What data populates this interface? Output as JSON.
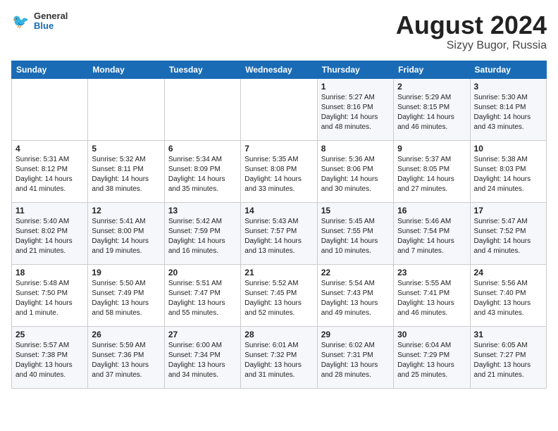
{
  "header": {
    "logo_line1": "General",
    "logo_line2": "Blue",
    "month_year": "August 2024",
    "location": "Sizyy Bugor, Russia"
  },
  "days_of_week": [
    "Sunday",
    "Monday",
    "Tuesday",
    "Wednesday",
    "Thursday",
    "Friday",
    "Saturday"
  ],
  "weeks": [
    [
      {
        "day": "",
        "info": ""
      },
      {
        "day": "",
        "info": ""
      },
      {
        "day": "",
        "info": ""
      },
      {
        "day": "",
        "info": ""
      },
      {
        "day": "1",
        "info": "Sunrise: 5:27 AM\nSunset: 8:16 PM\nDaylight: 14 hours\nand 48 minutes."
      },
      {
        "day": "2",
        "info": "Sunrise: 5:29 AM\nSunset: 8:15 PM\nDaylight: 14 hours\nand 46 minutes."
      },
      {
        "day": "3",
        "info": "Sunrise: 5:30 AM\nSunset: 8:14 PM\nDaylight: 14 hours\nand 43 minutes."
      }
    ],
    [
      {
        "day": "4",
        "info": "Sunrise: 5:31 AM\nSunset: 8:12 PM\nDaylight: 14 hours\nand 41 minutes."
      },
      {
        "day": "5",
        "info": "Sunrise: 5:32 AM\nSunset: 8:11 PM\nDaylight: 14 hours\nand 38 minutes."
      },
      {
        "day": "6",
        "info": "Sunrise: 5:34 AM\nSunset: 8:09 PM\nDaylight: 14 hours\nand 35 minutes."
      },
      {
        "day": "7",
        "info": "Sunrise: 5:35 AM\nSunset: 8:08 PM\nDaylight: 14 hours\nand 33 minutes."
      },
      {
        "day": "8",
        "info": "Sunrise: 5:36 AM\nSunset: 8:06 PM\nDaylight: 14 hours\nand 30 minutes."
      },
      {
        "day": "9",
        "info": "Sunrise: 5:37 AM\nSunset: 8:05 PM\nDaylight: 14 hours\nand 27 minutes."
      },
      {
        "day": "10",
        "info": "Sunrise: 5:38 AM\nSunset: 8:03 PM\nDaylight: 14 hours\nand 24 minutes."
      }
    ],
    [
      {
        "day": "11",
        "info": "Sunrise: 5:40 AM\nSunset: 8:02 PM\nDaylight: 14 hours\nand 21 minutes."
      },
      {
        "day": "12",
        "info": "Sunrise: 5:41 AM\nSunset: 8:00 PM\nDaylight: 14 hours\nand 19 minutes."
      },
      {
        "day": "13",
        "info": "Sunrise: 5:42 AM\nSunset: 7:59 PM\nDaylight: 14 hours\nand 16 minutes."
      },
      {
        "day": "14",
        "info": "Sunrise: 5:43 AM\nSunset: 7:57 PM\nDaylight: 14 hours\nand 13 minutes."
      },
      {
        "day": "15",
        "info": "Sunrise: 5:45 AM\nSunset: 7:55 PM\nDaylight: 14 hours\nand 10 minutes."
      },
      {
        "day": "16",
        "info": "Sunrise: 5:46 AM\nSunset: 7:54 PM\nDaylight: 14 hours\nand 7 minutes."
      },
      {
        "day": "17",
        "info": "Sunrise: 5:47 AM\nSunset: 7:52 PM\nDaylight: 14 hours\nand 4 minutes."
      }
    ],
    [
      {
        "day": "18",
        "info": "Sunrise: 5:48 AM\nSunset: 7:50 PM\nDaylight: 14 hours\nand 1 minute."
      },
      {
        "day": "19",
        "info": "Sunrise: 5:50 AM\nSunset: 7:49 PM\nDaylight: 13 hours\nand 58 minutes."
      },
      {
        "day": "20",
        "info": "Sunrise: 5:51 AM\nSunset: 7:47 PM\nDaylight: 13 hours\nand 55 minutes."
      },
      {
        "day": "21",
        "info": "Sunrise: 5:52 AM\nSunset: 7:45 PM\nDaylight: 13 hours\nand 52 minutes."
      },
      {
        "day": "22",
        "info": "Sunrise: 5:54 AM\nSunset: 7:43 PM\nDaylight: 13 hours\nand 49 minutes."
      },
      {
        "day": "23",
        "info": "Sunrise: 5:55 AM\nSunset: 7:41 PM\nDaylight: 13 hours\nand 46 minutes."
      },
      {
        "day": "24",
        "info": "Sunrise: 5:56 AM\nSunset: 7:40 PM\nDaylight: 13 hours\nand 43 minutes."
      }
    ],
    [
      {
        "day": "25",
        "info": "Sunrise: 5:57 AM\nSunset: 7:38 PM\nDaylight: 13 hours\nand 40 minutes."
      },
      {
        "day": "26",
        "info": "Sunrise: 5:59 AM\nSunset: 7:36 PM\nDaylight: 13 hours\nand 37 minutes."
      },
      {
        "day": "27",
        "info": "Sunrise: 6:00 AM\nSunset: 7:34 PM\nDaylight: 13 hours\nand 34 minutes."
      },
      {
        "day": "28",
        "info": "Sunrise: 6:01 AM\nSunset: 7:32 PM\nDaylight: 13 hours\nand 31 minutes."
      },
      {
        "day": "29",
        "info": "Sunrise: 6:02 AM\nSunset: 7:31 PM\nDaylight: 13 hours\nand 28 minutes."
      },
      {
        "day": "30",
        "info": "Sunrise: 6:04 AM\nSunset: 7:29 PM\nDaylight: 13 hours\nand 25 minutes."
      },
      {
        "day": "31",
        "info": "Sunrise: 6:05 AM\nSunset: 7:27 PM\nDaylight: 13 hours\nand 21 minutes."
      }
    ]
  ]
}
